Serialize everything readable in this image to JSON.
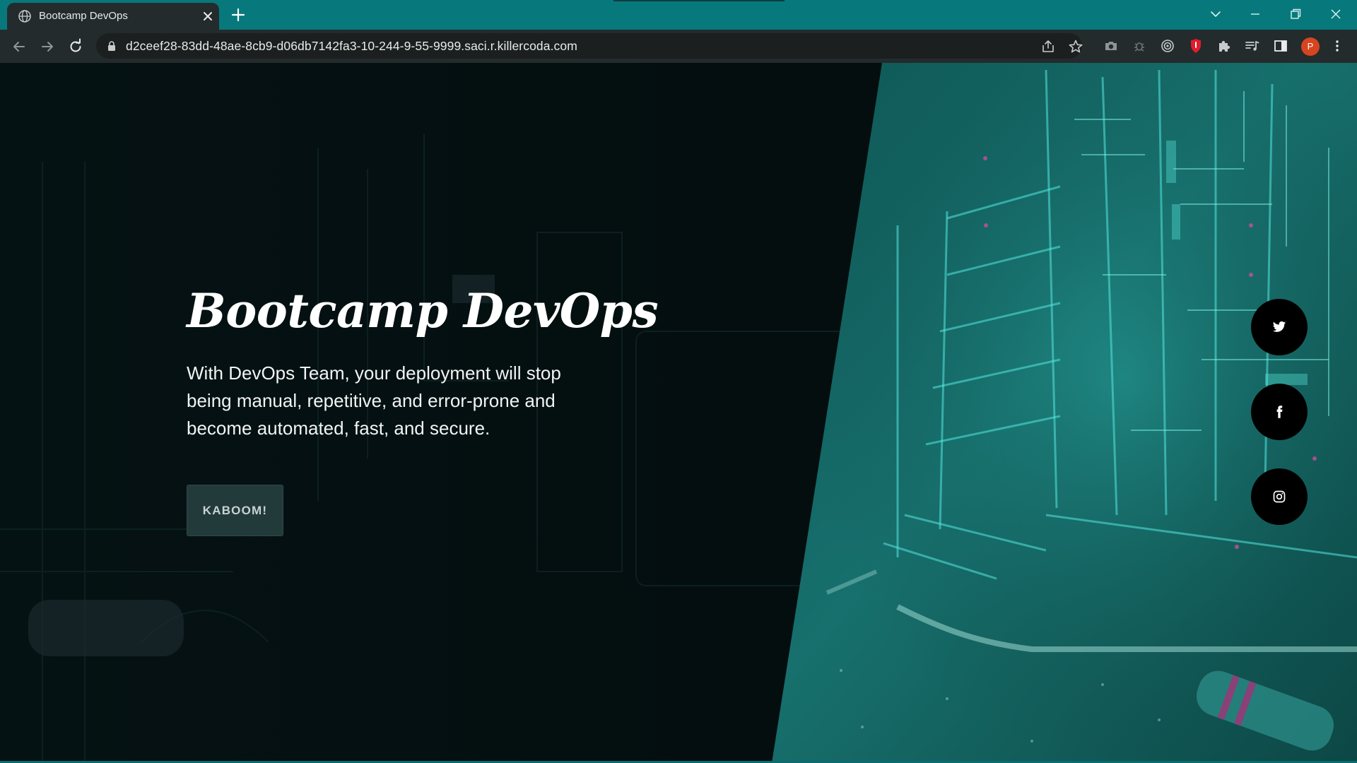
{
  "browser": {
    "tab": {
      "title": "Bootcamp DevOps",
      "favicon": "globe-icon"
    },
    "address_bar": {
      "url": "d2ceef28-83dd-48ae-8cb9-d06db7142fa3-10-244-9-55-9999.saci.r.killercoda.com"
    },
    "profile_initial": "P",
    "colors": {
      "tabstrip": "#07797c",
      "toolbar": "#242b2c",
      "profile": "#d6451f"
    }
  },
  "hero": {
    "title": "Bootcamp DevOps",
    "description": "With DevOps Team, your deployment will stop being manual, repetitive, and error-prone and become automated, fast, and secure.",
    "cta_label": "KABOOM!"
  },
  "social": [
    {
      "name": "twitter",
      "icon": "twitter-icon"
    },
    {
      "name": "facebook",
      "icon": "facebook-icon"
    },
    {
      "name": "instagram",
      "icon": "instagram-icon"
    }
  ],
  "colors": {
    "accent_teal": "#3fc6c0",
    "page_dark": "#041012",
    "button_bg": "#233a3b"
  }
}
